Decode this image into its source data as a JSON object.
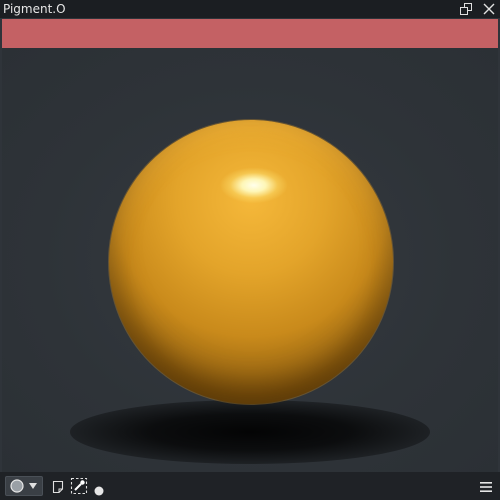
{
  "window": {
    "title": "Pigment.O"
  },
  "swatch": {
    "color": "#c46164"
  },
  "preview": {
    "sphere_color": "#e3a42a",
    "background": "#2f343a"
  },
  "toolbar": {
    "icons": [
      "circle-shape-icon",
      "chevron-down-icon",
      "note-icon",
      "color-picker-selection-icon",
      "dot-icon",
      "hamburger-menu-icon"
    ]
  }
}
